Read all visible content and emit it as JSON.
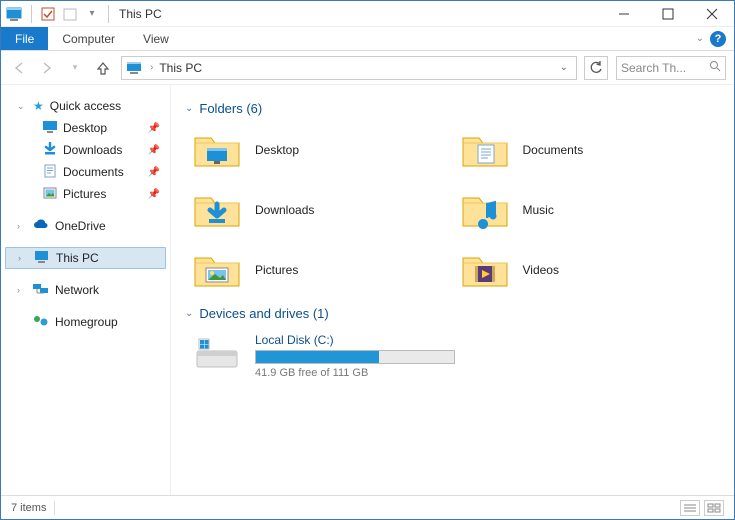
{
  "window": {
    "title": "This PC"
  },
  "ribbon": {
    "file": "File",
    "tabs": [
      "Computer",
      "View"
    ]
  },
  "address": {
    "path": "This PC",
    "search_placeholder": "Search Th..."
  },
  "sidebar": {
    "quickaccess": {
      "label": "Quick access"
    },
    "qa_items": [
      {
        "label": "Desktop",
        "icon": "desktop"
      },
      {
        "label": "Downloads",
        "icon": "downloads"
      },
      {
        "label": "Documents",
        "icon": "documents"
      },
      {
        "label": "Pictures",
        "icon": "pictures"
      }
    ],
    "onedrive": "OneDrive",
    "thispc": "This PC",
    "network": "Network",
    "homegroup": "Homegroup"
  },
  "groups": {
    "folders_header": "Folders (6)",
    "drives_header": "Devices and drives (1)"
  },
  "folders": [
    {
      "label": "Desktop",
      "icon": "desktop"
    },
    {
      "label": "Documents",
      "icon": "documents"
    },
    {
      "label": "Downloads",
      "icon": "downloads"
    },
    {
      "label": "Music",
      "icon": "music"
    },
    {
      "label": "Pictures",
      "icon": "pictures"
    },
    {
      "label": "Videos",
      "icon": "videos"
    }
  ],
  "drive": {
    "name": "Local Disk (C:)",
    "free_text": "41.9 GB free of 111 GB",
    "used_pct": 62
  },
  "status": {
    "items": "7 items"
  },
  "colors": {
    "accent": "#1979ca",
    "folder_fill": "#ffe29a",
    "folder_stroke": "#d9a400",
    "header_text": "#0b4e8c"
  }
}
